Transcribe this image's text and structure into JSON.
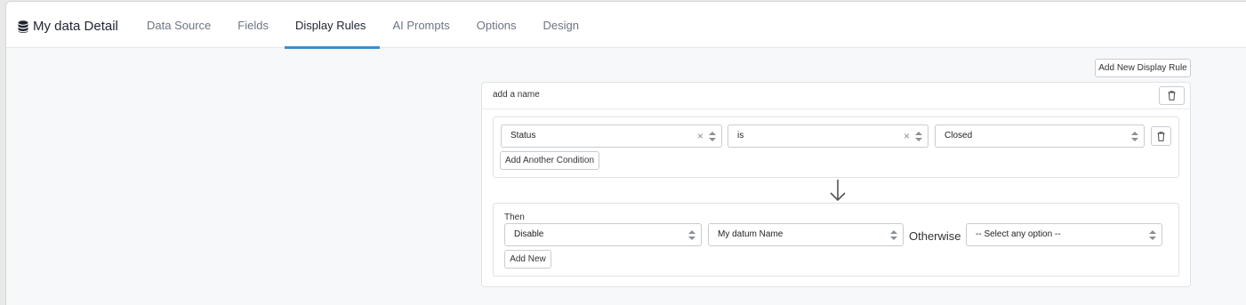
{
  "header": {
    "app_title": "My data Detail",
    "tabs": [
      {
        "label": "Data Source"
      },
      {
        "label": "Fields"
      },
      {
        "label": "Display Rules",
        "active": true
      },
      {
        "label": "AI Prompts"
      },
      {
        "label": "Options"
      },
      {
        "label": "Design"
      }
    ]
  },
  "toolbar": {
    "add_rule_label": "Add New Display Rule"
  },
  "rule": {
    "name": "add a name",
    "condition": {
      "field": "Status",
      "operator": "is",
      "value": "Closed",
      "add_condition_label": "Add Another Condition"
    },
    "then": {
      "label": "Then",
      "action": "Disable",
      "target": "My datum Name",
      "otherwise_label": "Otherwise",
      "otherwise_value": "-- Select any option --",
      "add_new_label": "Add New"
    }
  },
  "colors": {
    "accent": "#3a8fd0",
    "border": "#c8ccd1",
    "background": "#f7f8f9"
  }
}
